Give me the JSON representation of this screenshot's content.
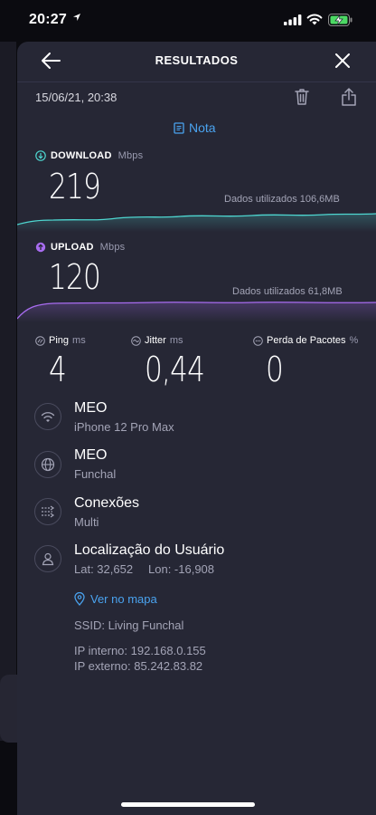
{
  "status_bar": {
    "time": "20:27"
  },
  "header": {
    "title": "RESULTADOS"
  },
  "date": "15/06/21, 20:38",
  "note_label": "Nota",
  "download": {
    "label": "DOWNLOAD",
    "unit": "Mbps",
    "value": "219",
    "data_used": "Dados utilizados 106,6MB",
    "color": "#4ed6d0"
  },
  "upload": {
    "label": "UPLOAD",
    "unit": "Mbps",
    "value": "120",
    "data_used": "Dados utilizados 61,8MB",
    "color": "#a86cf0"
  },
  "ping": {
    "label": "Ping",
    "unit": "ms",
    "value": "4"
  },
  "jitter": {
    "label": "Jitter",
    "unit": "ms",
    "value": "0,44"
  },
  "packet_loss": {
    "label": "Perda de Pacotes",
    "unit": "%",
    "value": "0"
  },
  "info": [
    {
      "icon": "wifi-icon",
      "title": "MEO",
      "subtitle": "iPhone 12 Pro Max"
    },
    {
      "icon": "globe-icon",
      "title": "MEO",
      "subtitle": "Funchal"
    },
    {
      "icon": "connections-icon",
      "title": "Conexões",
      "subtitle": "Multi"
    },
    {
      "icon": "user-icon",
      "title": "Localização do Usuário",
      "lat": "Lat: 32,652",
      "lon": "Lon: -16,908"
    }
  ],
  "map_link": "Ver no mapa",
  "ssid": "SSID: Living Funchal",
  "ip_internal": "IP interno: 192.168.0.155",
  "ip_external": "IP externo: 85.242.83.82",
  "colors": {
    "accent": "#4aa3ef",
    "card": "#262735",
    "battery": "#4cd964"
  }
}
